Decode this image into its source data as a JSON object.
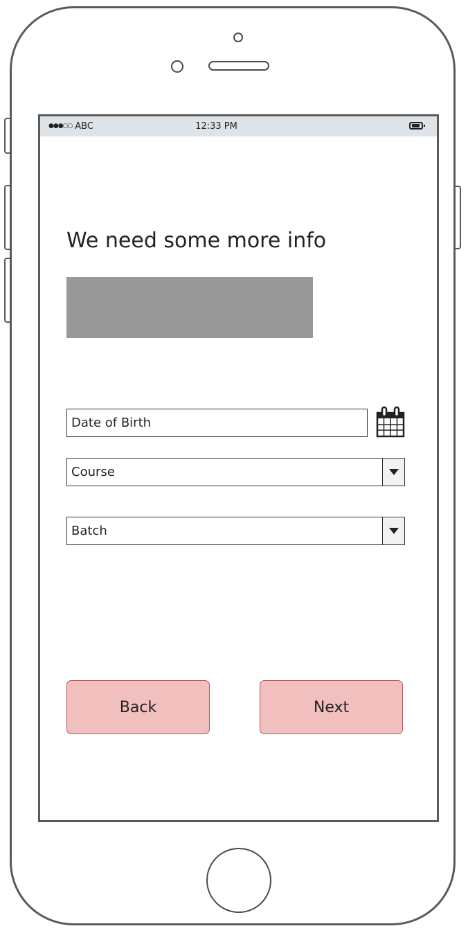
{
  "status_bar": {
    "carrier": "ABC",
    "signal_dots": "●●●○○",
    "time": "12:33 PM",
    "battery_icon": "battery-icon"
  },
  "main": {
    "title": "We need some more info",
    "image_placeholder_color": "#999999",
    "fields": {
      "date_of_birth": {
        "placeholder": "Date of Birth",
        "icon": "calendar-icon"
      },
      "course": {
        "selected": "Course",
        "icon": "chevron-down-icon"
      },
      "batch": {
        "selected": "Batch",
        "icon": "chevron-down-icon"
      }
    },
    "buttons": {
      "back_label": "Back",
      "next_label": "Next"
    }
  },
  "colors": {
    "button_fill": "#f2bfbf",
    "button_border": "#b05a5a",
    "status_bar_bg": "#dde3e6",
    "device_outline": "#5a5a5a"
  }
}
